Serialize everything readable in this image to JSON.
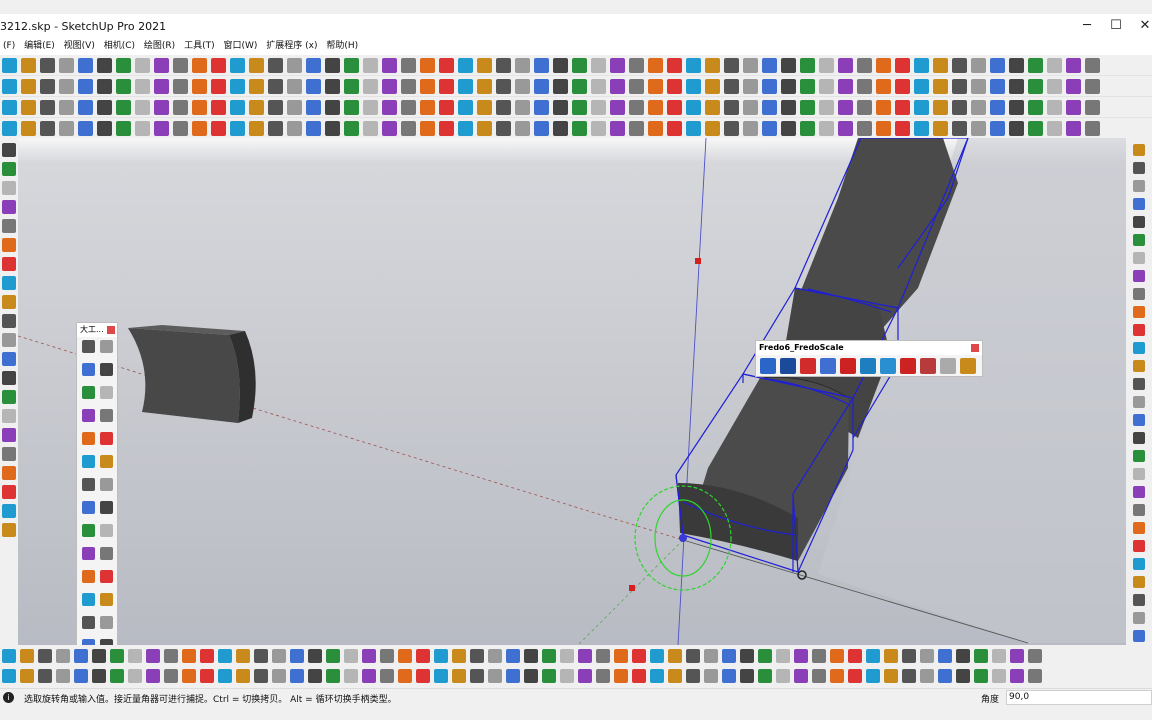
{
  "window": {
    "title": "3212.skp - SketchUp Pro 2021",
    "minimize": "─",
    "maximize": "☐",
    "close": "✕"
  },
  "menu": [
    "(F)",
    "编辑(E)",
    "视图(V)",
    "相机(C)",
    "绘图(R)",
    "工具(T)",
    "窗口(W)",
    "扩展程序 (x)",
    "帮助(H)"
  ],
  "panels": {
    "tools_title": "大工...",
    "fredo_title": "Fredo6_FredoScale",
    "fredo_icons": [
      "box-scale-icon",
      "tapering-icon",
      "stretch-icon",
      "bend-icon",
      "twist-icon",
      "skew-icon",
      "shear-icon",
      "rotate-icon",
      "radial-bend-icon",
      "undo-icon",
      "settings-icon"
    ]
  },
  "status": {
    "info_icon": "info-icon",
    "message": "选取旋转角或输入值。接近量角器可进行捕捉。Ctrl = 切换拷贝。 Alt = 循环切换手柄类型。",
    "measure_label": "角度",
    "measure_value": "90,0"
  },
  "colors": {
    "selection": "#1f1fd6",
    "protractor": "#2fd42f",
    "solid": "#474747",
    "background_top": "#ffffff",
    "background_bottom": "#b9bcc4"
  }
}
